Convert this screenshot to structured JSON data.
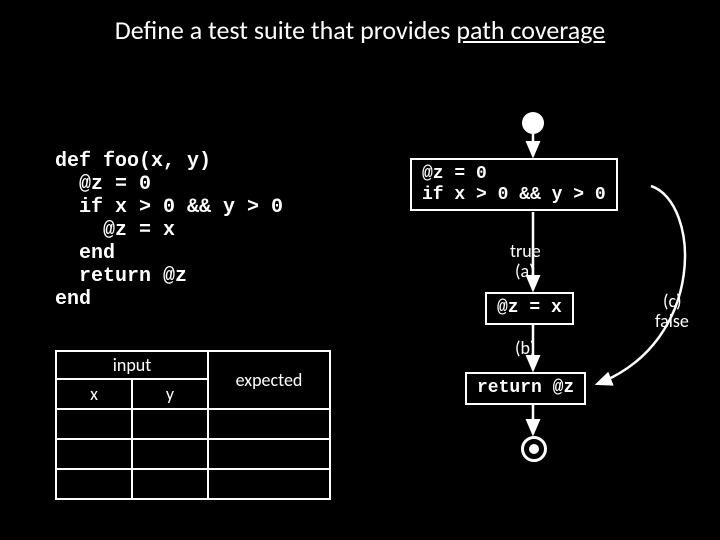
{
  "title_prefix": "Define a test suite that provides ",
  "title_underline": "path coverage",
  "code": "def foo(x, y)\n  @z = 0\n  if x > 0 && y > 0\n    @z = x\n  end\n  return @z\nend",
  "table": {
    "input_header": "input",
    "x_header": "x",
    "y_header": "y",
    "expected_header": "expected",
    "rows": [
      {
        "x": "",
        "y": "",
        "expected": ""
      },
      {
        "x": "",
        "y": "",
        "expected": ""
      },
      {
        "x": "",
        "y": "",
        "expected": ""
      }
    ]
  },
  "flowchart": {
    "node1": "@z = 0\nif x > 0 && y > 0",
    "node2": "@z = x",
    "node3": "return @z",
    "label_true": "true",
    "label_a": "(a)",
    "label_b": "(b)",
    "label_c": "(c)",
    "label_false": "false"
  }
}
